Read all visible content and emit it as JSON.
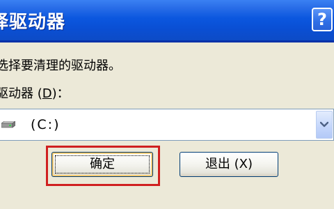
{
  "dialog": {
    "title": "择驱动器",
    "help_label": "?"
  },
  "prompt": {
    "text": "选择要清理的驱动器。"
  },
  "drive_select": {
    "label_prefix": "驱动器 (",
    "label_accel": "D",
    "label_suffix": ")：",
    "selected_value": "(C:)"
  },
  "buttons": {
    "ok_label": "确定",
    "quit_label": "退出 (X)"
  },
  "colors": {
    "titlebar": "#0a4fd4",
    "highlight": "#d02020"
  }
}
